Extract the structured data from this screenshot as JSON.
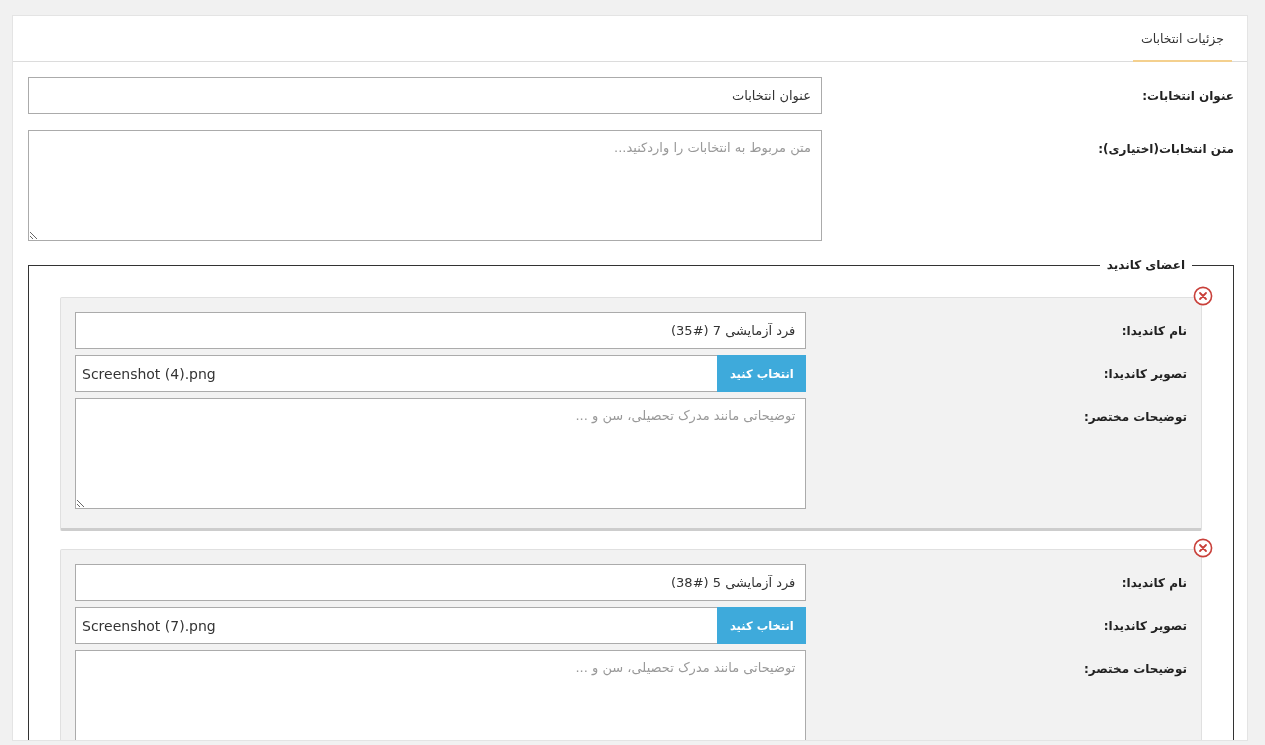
{
  "tabs": [
    {
      "label": "جزئیات انتخابات",
      "selected": true
    }
  ],
  "form": {
    "fields": [
      {
        "kind": "text",
        "label": "عنوان انتخابات:",
        "value": "عنوان انتخابات"
      },
      {
        "kind": "textarea",
        "label": "متن انتخابات(اختیاری):",
        "placeholder": "متن مربوط به انتخابات را واردکنید..."
      }
    ]
  },
  "candidates": {
    "legend": "اعضای کاندید",
    "items": [
      {
        "fields": [
          {
            "kind": "text",
            "label": "نام کاندیدا:",
            "value": "فرد آزمایشی 7 (#35)"
          },
          {
            "kind": "file",
            "label": "تصویر کاندیدا:",
            "button": "انتخاب کنید",
            "value": "Screenshot (4).png"
          },
          {
            "kind": "textarea",
            "label": "توضیحات مختصر:",
            "placeholder": "توضیحاتی مانند مدرک تحصیلی، سن و ..."
          }
        ]
      },
      {
        "fields": [
          {
            "kind": "text",
            "label": "نام کاندیدا:",
            "value": "فرد آزمایشی 5 (#38)"
          },
          {
            "kind": "file",
            "label": "تصویر کاندیدا:",
            "button": "انتخاب کنید",
            "value": "Screenshot (7).png"
          },
          {
            "kind": "textarea",
            "label": "توضیحات مختصر:",
            "placeholder": "توضیحاتی مانند مدرک تحصیلی، سن و ..."
          }
        ]
      }
    ]
  }
}
